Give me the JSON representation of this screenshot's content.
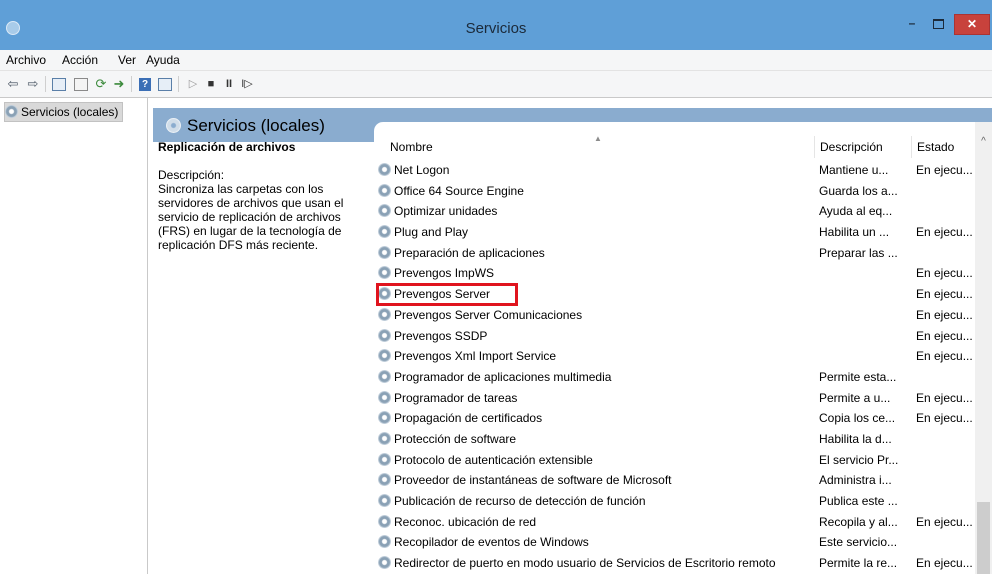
{
  "window": {
    "title": "Servicios"
  },
  "menu": {
    "items": [
      "Archivo",
      "Acción",
      "Ver",
      "Ayuda"
    ]
  },
  "toolbar": {
    "icons": [
      "back-arrow-icon",
      "forward-arrow-icon",
      "console-tree-icon",
      "properties-icon",
      "refresh-icon",
      "export-list-icon",
      "help-icon",
      "show-pane-icon",
      "play-icon",
      "stop-icon",
      "pause-icon",
      "restart-icon"
    ]
  },
  "tree": {
    "selected": "Servicios (locales)"
  },
  "header": {
    "title": "Servicios (locales)"
  },
  "detail": {
    "title": "Replicación de archivos",
    "description_label": "Descripción:",
    "description": "Sincroniza las carpetas con los servidores de archivos que usan el servicio de replicación de archivos (FRS) en lugar de la tecnología de replicación DFS más reciente."
  },
  "table": {
    "columns": {
      "name": "Nombre",
      "description": "Descripción",
      "state": "Estado"
    },
    "rows": [
      {
        "name": "Net Logon",
        "description": "Mantiene u...",
        "state": "En ejecu..."
      },
      {
        "name": "Office 64 Source Engine",
        "description": "Guarda los a...",
        "state": ""
      },
      {
        "name": "Optimizar unidades",
        "description": "Ayuda al eq...",
        "state": ""
      },
      {
        "name": "Plug and Play",
        "description": "Habilita un ...",
        "state": "En ejecu..."
      },
      {
        "name": "Preparación de aplicaciones",
        "description": "Preparar las ...",
        "state": ""
      },
      {
        "name": "Prevengos ImpWS",
        "description": "",
        "state": "En ejecu..."
      },
      {
        "name": "Prevengos Server",
        "description": "",
        "state": "En ejecu..."
      },
      {
        "name": "Prevengos Server Comunicaciones",
        "description": "",
        "state": "En ejecu..."
      },
      {
        "name": "Prevengos SSDP",
        "description": "",
        "state": "En ejecu..."
      },
      {
        "name": "Prevengos Xml Import Service",
        "description": "",
        "state": "En ejecu..."
      },
      {
        "name": "Programador de aplicaciones multimedia",
        "description": "Permite esta...",
        "state": ""
      },
      {
        "name": "Programador de tareas",
        "description": "Permite a u...",
        "state": "En ejecu..."
      },
      {
        "name": "Propagación de certificados",
        "description": "Copia los ce...",
        "state": "En ejecu..."
      },
      {
        "name": "Protección de software",
        "description": "Habilita la d...",
        "state": ""
      },
      {
        "name": "Protocolo de autenticación extensible",
        "description": "El servicio Pr...",
        "state": ""
      },
      {
        "name": "Proveedor de instantáneas de software de Microsoft",
        "description": "Administra i...",
        "state": ""
      },
      {
        "name": "Publicación de recurso de detección de función",
        "description": "Publica este ...",
        "state": ""
      },
      {
        "name": "Reconoc. ubicación de red",
        "description": "Recopila y al...",
        "state": "En ejecu..."
      },
      {
        "name": "Recopilador de eventos de Windows",
        "description": "Este servicio...",
        "state": ""
      },
      {
        "name": "Redirector de puerto en modo usuario de Servicios de Escritorio remoto",
        "description": "Permite la re...",
        "state": "En ejecu..."
      }
    ]
  },
  "colors": {
    "titlebar": "#5f9fd7",
    "header_band": "#8aaccf",
    "close_button": "#c8423c",
    "highlight": "#e0141e"
  }
}
